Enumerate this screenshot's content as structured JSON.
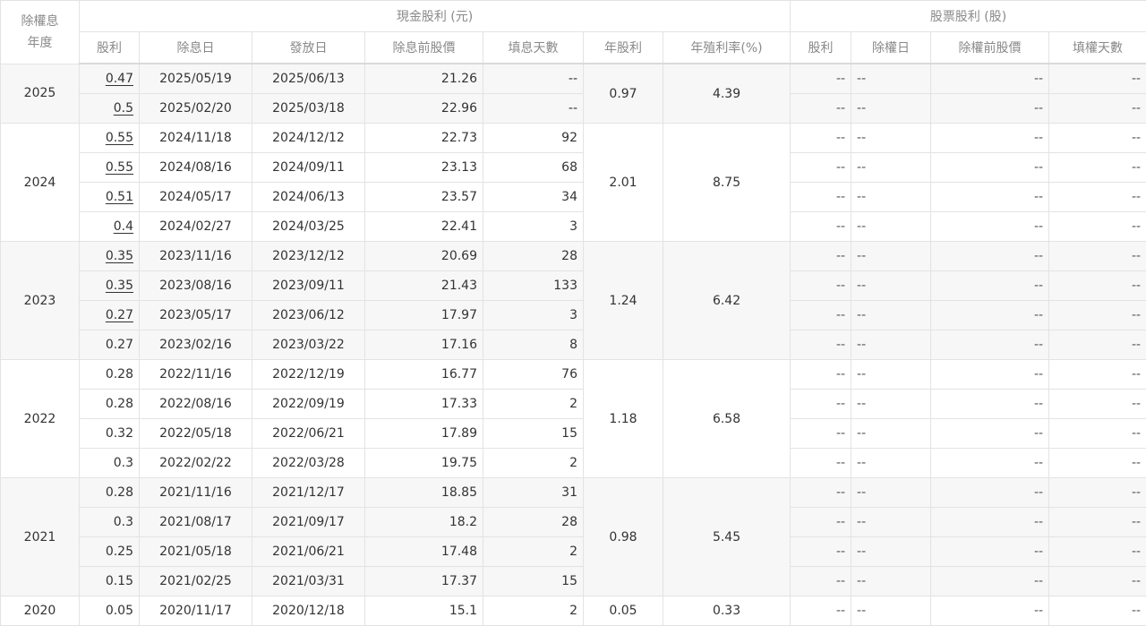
{
  "header": {
    "year_col": "除權息年度",
    "year_col_line1": "除權息",
    "year_col_line2": "年度",
    "cash_group": "現金股利 (元)",
    "stock_group": "股票股利 (股)",
    "cash_cols": [
      "股利",
      "除息日",
      "發放日",
      "除息前股價",
      "填息天數",
      "年股利",
      "年殖利率(%)"
    ],
    "stock_cols": [
      "股利",
      "除權日",
      "除權前股價",
      "填權天數"
    ]
  },
  "dash": "--",
  "years": [
    {
      "year": "2025",
      "annual": "0.97",
      "yield": "4.39",
      "rows": [
        {
          "div": "0.47",
          "link": true,
          "ex": "2025/05/19",
          "pay": "2025/06/13",
          "price": "21.26",
          "days": "--"
        },
        {
          "div": "0.5",
          "link": true,
          "ex": "2025/02/20",
          "pay": "2025/03/18",
          "price": "22.96",
          "days": "--"
        }
      ]
    },
    {
      "year": "2024",
      "annual": "2.01",
      "yield": "8.75",
      "rows": [
        {
          "div": "0.55",
          "link": true,
          "ex": "2024/11/18",
          "pay": "2024/12/12",
          "price": "22.73",
          "days": "92"
        },
        {
          "div": "0.55",
          "link": true,
          "ex": "2024/08/16",
          "pay": "2024/09/11",
          "price": "23.13",
          "days": "68"
        },
        {
          "div": "0.51",
          "link": true,
          "ex": "2024/05/17",
          "pay": "2024/06/13",
          "price": "23.57",
          "days": "34"
        },
        {
          "div": "0.4",
          "link": true,
          "ex": "2024/02/27",
          "pay": "2024/03/25",
          "price": "22.41",
          "days": "3"
        }
      ]
    },
    {
      "year": "2023",
      "annual": "1.24",
      "yield": "6.42",
      "rows": [
        {
          "div": "0.35",
          "link": true,
          "ex": "2023/11/16",
          "pay": "2023/12/12",
          "price": "20.69",
          "days": "28"
        },
        {
          "div": "0.35",
          "link": true,
          "ex": "2023/08/16",
          "pay": "2023/09/11",
          "price": "21.43",
          "days": "133"
        },
        {
          "div": "0.27",
          "link": true,
          "ex": "2023/05/17",
          "pay": "2023/06/12",
          "price": "17.97",
          "days": "3"
        },
        {
          "div": "0.27",
          "link": false,
          "ex": "2023/02/16",
          "pay": "2023/03/22",
          "price": "17.16",
          "days": "8"
        }
      ]
    },
    {
      "year": "2022",
      "annual": "1.18",
      "yield": "6.58",
      "rows": [
        {
          "div": "0.28",
          "link": false,
          "ex": "2022/11/16",
          "pay": "2022/12/19",
          "price": "16.77",
          "days": "76"
        },
        {
          "div": "0.28",
          "link": false,
          "ex": "2022/08/16",
          "pay": "2022/09/19",
          "price": "17.33",
          "days": "2"
        },
        {
          "div": "0.32",
          "link": false,
          "ex": "2022/05/18",
          "pay": "2022/06/21",
          "price": "17.89",
          "days": "15"
        },
        {
          "div": "0.3",
          "link": false,
          "ex": "2022/02/22",
          "pay": "2022/03/28",
          "price": "19.75",
          "days": "2"
        }
      ]
    },
    {
      "year": "2021",
      "annual": "0.98",
      "yield": "5.45",
      "rows": [
        {
          "div": "0.28",
          "link": false,
          "ex": "2021/11/16",
          "pay": "2021/12/17",
          "price": "18.85",
          "days": "31"
        },
        {
          "div": "0.3",
          "link": false,
          "ex": "2021/08/17",
          "pay": "2021/09/17",
          "price": "18.2",
          "days": "28"
        },
        {
          "div": "0.25",
          "link": false,
          "ex": "2021/05/18",
          "pay": "2021/06/21",
          "price": "17.48",
          "days": "2"
        },
        {
          "div": "0.15",
          "link": false,
          "ex": "2021/02/25",
          "pay": "2021/03/31",
          "price": "17.37",
          "days": "15"
        }
      ]
    },
    {
      "year": "2020",
      "annual": "0.05",
      "yield": "0.33",
      "rows": [
        {
          "div": "0.05",
          "link": false,
          "ex": "2020/11/17",
          "pay": "2020/12/18",
          "price": "15.1",
          "days": "2"
        }
      ]
    }
  ]
}
